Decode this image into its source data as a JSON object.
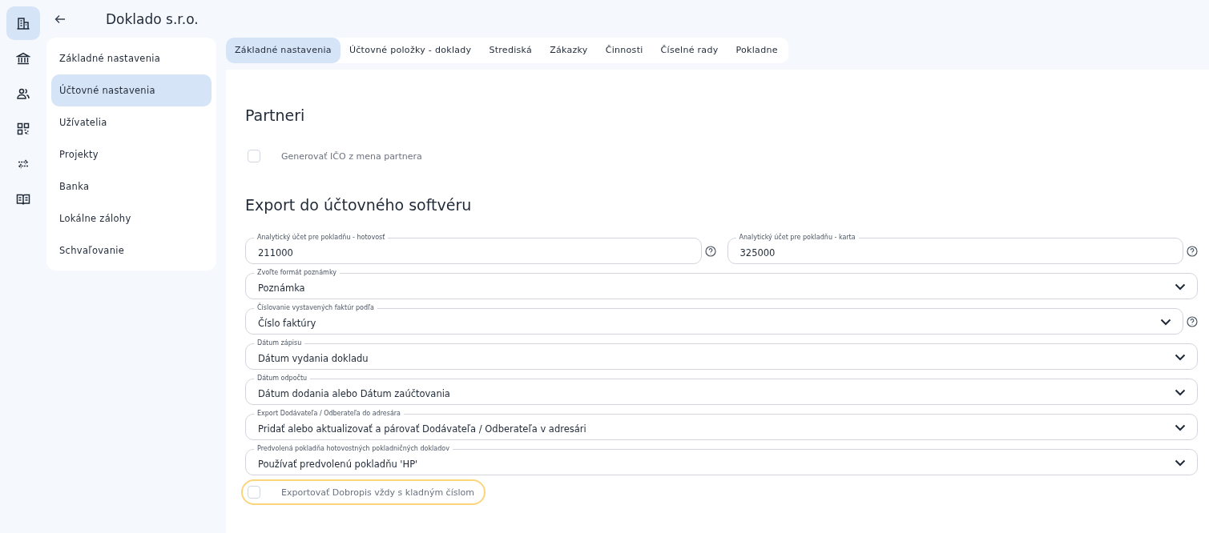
{
  "rail": [
    {
      "selected": true
    },
    {
      "selected": false
    },
    {
      "selected": false
    },
    {
      "selected": false
    },
    {
      "selected": false
    },
    {
      "selected": false
    }
  ],
  "header": {
    "title": "Doklado s.r.o."
  },
  "sidebar": {
    "items": [
      {
        "label": "Základné nastavenia",
        "selected": false
      },
      {
        "label": "Účtovné nastavenia",
        "selected": true
      },
      {
        "label": "Užívatelia",
        "selected": false
      },
      {
        "label": "Projekty",
        "selected": false
      },
      {
        "label": "Banka",
        "selected": false
      },
      {
        "label": "Lokálne zálohy",
        "selected": false
      },
      {
        "label": "Schvaľovanie",
        "selected": false
      }
    ]
  },
  "tabs": [
    {
      "label": "Základné nastavenia",
      "selected": true
    },
    {
      "label": "Účtovné položky - doklady",
      "selected": false
    },
    {
      "label": "Strediská",
      "selected": false
    },
    {
      "label": "Zákazky",
      "selected": false
    },
    {
      "label": "Činnosti",
      "selected": false
    },
    {
      "label": "Číselné rady",
      "selected": false
    },
    {
      "label": "Pokladne",
      "selected": false
    }
  ],
  "sections": [
    {
      "title": "Partneri",
      "items": [
        {
          "kind": "checkbox",
          "label": "Generovať IČO z mena partnera",
          "checked": false,
          "highlighted": false
        }
      ]
    },
    {
      "title": "Export do účtovného softvéru",
      "items": [
        {
          "kind": "row",
          "fields": [
            {
              "kind": "text",
              "label": "Analytický účet pre pokladňu - hotovosť",
              "value": "211000",
              "help": true
            },
            {
              "kind": "text",
              "label": "Analytický účet pre pokladňu - karta",
              "value": "325000",
              "help": true
            }
          ]
        },
        {
          "kind": "row",
          "fields": [
            {
              "kind": "select",
              "label": "Zvoľte formát poznámky",
              "value": "Poznámka",
              "help": false
            }
          ]
        },
        {
          "kind": "row",
          "fields": [
            {
              "kind": "select",
              "label": "Číslovanie vystavených faktúr podľa",
              "value": "Číslo faktúry",
              "help": true
            }
          ]
        },
        {
          "kind": "row",
          "fields": [
            {
              "kind": "select",
              "label": "Dátum zápisu",
              "value": "Dátum vydania dokladu",
              "help": false
            }
          ]
        },
        {
          "kind": "row",
          "fields": [
            {
              "kind": "select",
              "label": "Dátum odpočtu",
              "value": "Dátum dodania alebo Dátum zaúčtovania",
              "help": false
            }
          ]
        },
        {
          "kind": "row",
          "fields": [
            {
              "kind": "select",
              "label": "Export Dodávateľa / Odberateľa do adresára",
              "value": "Pridať alebo aktualizovať a párovať Dodávateľa / Odberateľa v adresári",
              "help": false
            }
          ]
        },
        {
          "kind": "row",
          "fields": [
            {
              "kind": "select",
              "label": "Predvolená pokladňa hotovostných pokladničných dokladov",
              "value": "Používať predvolenú pokladňu 'HP'",
              "help": false
            }
          ]
        },
        {
          "kind": "checkbox",
          "label": "Exportovať Dobropis vždy s kladným číslom",
          "checked": false,
          "highlighted": true
        }
      ]
    }
  ]
}
